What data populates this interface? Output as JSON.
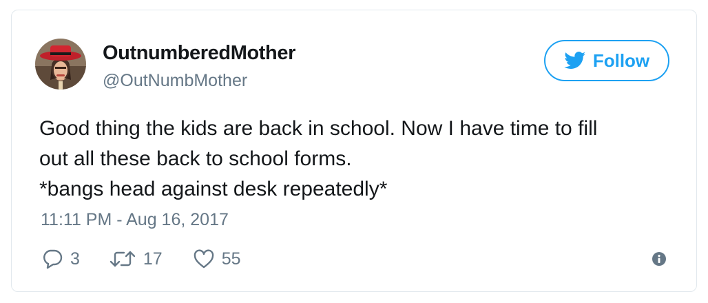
{
  "tweet": {
    "user": {
      "display_name": "OutnumberedMother",
      "handle": "@OutNumbMother",
      "avatar_icon": "user-avatar-photo"
    },
    "follow_button": {
      "label": "Follow",
      "icon": "twitter-bird-icon"
    },
    "text_lines": [
      "Good thing the kids are back in school. Now I have time to fill",
      "out all these back to school forms.",
      "*bangs head against desk repeatedly*"
    ],
    "timestamp": "11:11 PM - Aug 16, 2017",
    "actions": {
      "reply": {
        "count": "3",
        "icon": "reply-icon"
      },
      "retweet": {
        "count": "17",
        "icon": "retweet-icon"
      },
      "like": {
        "count": "55",
        "icon": "heart-icon"
      },
      "info": {
        "icon": "info-icon"
      }
    },
    "colors": {
      "accent": "#1da1f2",
      "text": "#14171a",
      "secondary_text": "#657786",
      "border": "#e1e8ed"
    }
  }
}
